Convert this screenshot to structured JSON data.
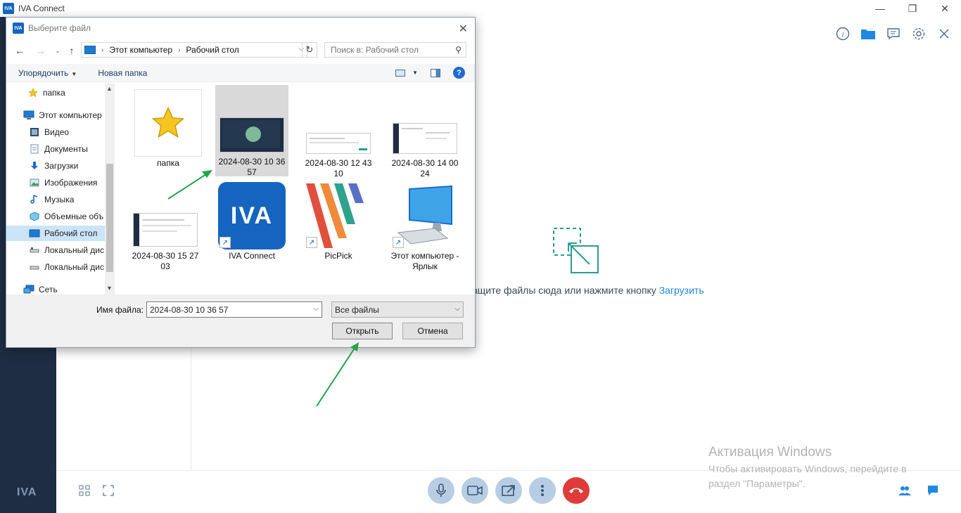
{
  "app": {
    "title": "IVA Connect",
    "logo_text": "IVA",
    "window_controls": [
      "—",
      "❐",
      "✕"
    ]
  },
  "drop_area": {
    "text": "ащите файлы сюда или нажмите кнопку ",
    "link": "Загрузить"
  },
  "rail": {
    "logo": "IVA"
  },
  "activation": {
    "title": "Активация Windows",
    "subtitle": "Чтобы активировать Windows, перейдите в раздел \"Параметры\"."
  },
  "dialog": {
    "title": "Выберите файл",
    "close": "✕",
    "address": {
      "computer": "Этот компьютер",
      "folder": "Рабочий стол"
    },
    "search_placeholder": "Поиск в: Рабочий стол",
    "commands": {
      "organize": "Упорядочить",
      "new_folder": "Новая папка"
    },
    "nav_items": [
      {
        "label": "папка",
        "icon": "star-icon"
      },
      {
        "label": "Этот компьютер",
        "icon": "computer-icon"
      },
      {
        "label": "Видео",
        "icon": "video-icon"
      },
      {
        "label": "Документы",
        "icon": "documents-icon"
      },
      {
        "label": "Загрузки",
        "icon": "download-icon"
      },
      {
        "label": "Изображения",
        "icon": "images-icon"
      },
      {
        "label": "Музыка",
        "icon": "music-icon"
      },
      {
        "label": "Объемные объ",
        "icon": "3d-icon"
      },
      {
        "label": "Рабочий стол",
        "icon": "desktop-icon"
      },
      {
        "label": "Локальный дис",
        "icon": "disk-icon"
      },
      {
        "label": "Локальный дис",
        "icon": "disk-icon"
      },
      {
        "label": "Сеть",
        "icon": "network-icon"
      }
    ],
    "files": [
      {
        "label": "папка",
        "type": "folder-star"
      },
      {
        "label": "2024-08-30 10 36 57",
        "type": "screenshot",
        "selected": true
      },
      {
        "label": "2024-08-30 12 43 10",
        "type": "screenshot"
      },
      {
        "label": "2024-08-30 14 00 24",
        "type": "screenshot"
      },
      {
        "label": "2024-08-30 15 27 03",
        "type": "screenshot"
      },
      {
        "label": "IVA Connect",
        "type": "app-shortcut"
      },
      {
        "label": "PicPick",
        "type": "app-shortcut"
      },
      {
        "label": "Этот компьютер - Ярлык",
        "type": "computer-shortcut"
      }
    ],
    "filename_label": "Имя файла:",
    "filename_value": "2024-08-30 10 36 57",
    "filetype": "Все файлы",
    "open_button": "Открыть",
    "cancel_button": "Отмена"
  },
  "colors": {
    "rail": "#1f2d44",
    "accent": "#1e88e5",
    "hangup": "#e03b3b",
    "call_btn": "#b7cde4",
    "drop_icon": "#2a9d8f",
    "arrow": "#22a34a"
  }
}
